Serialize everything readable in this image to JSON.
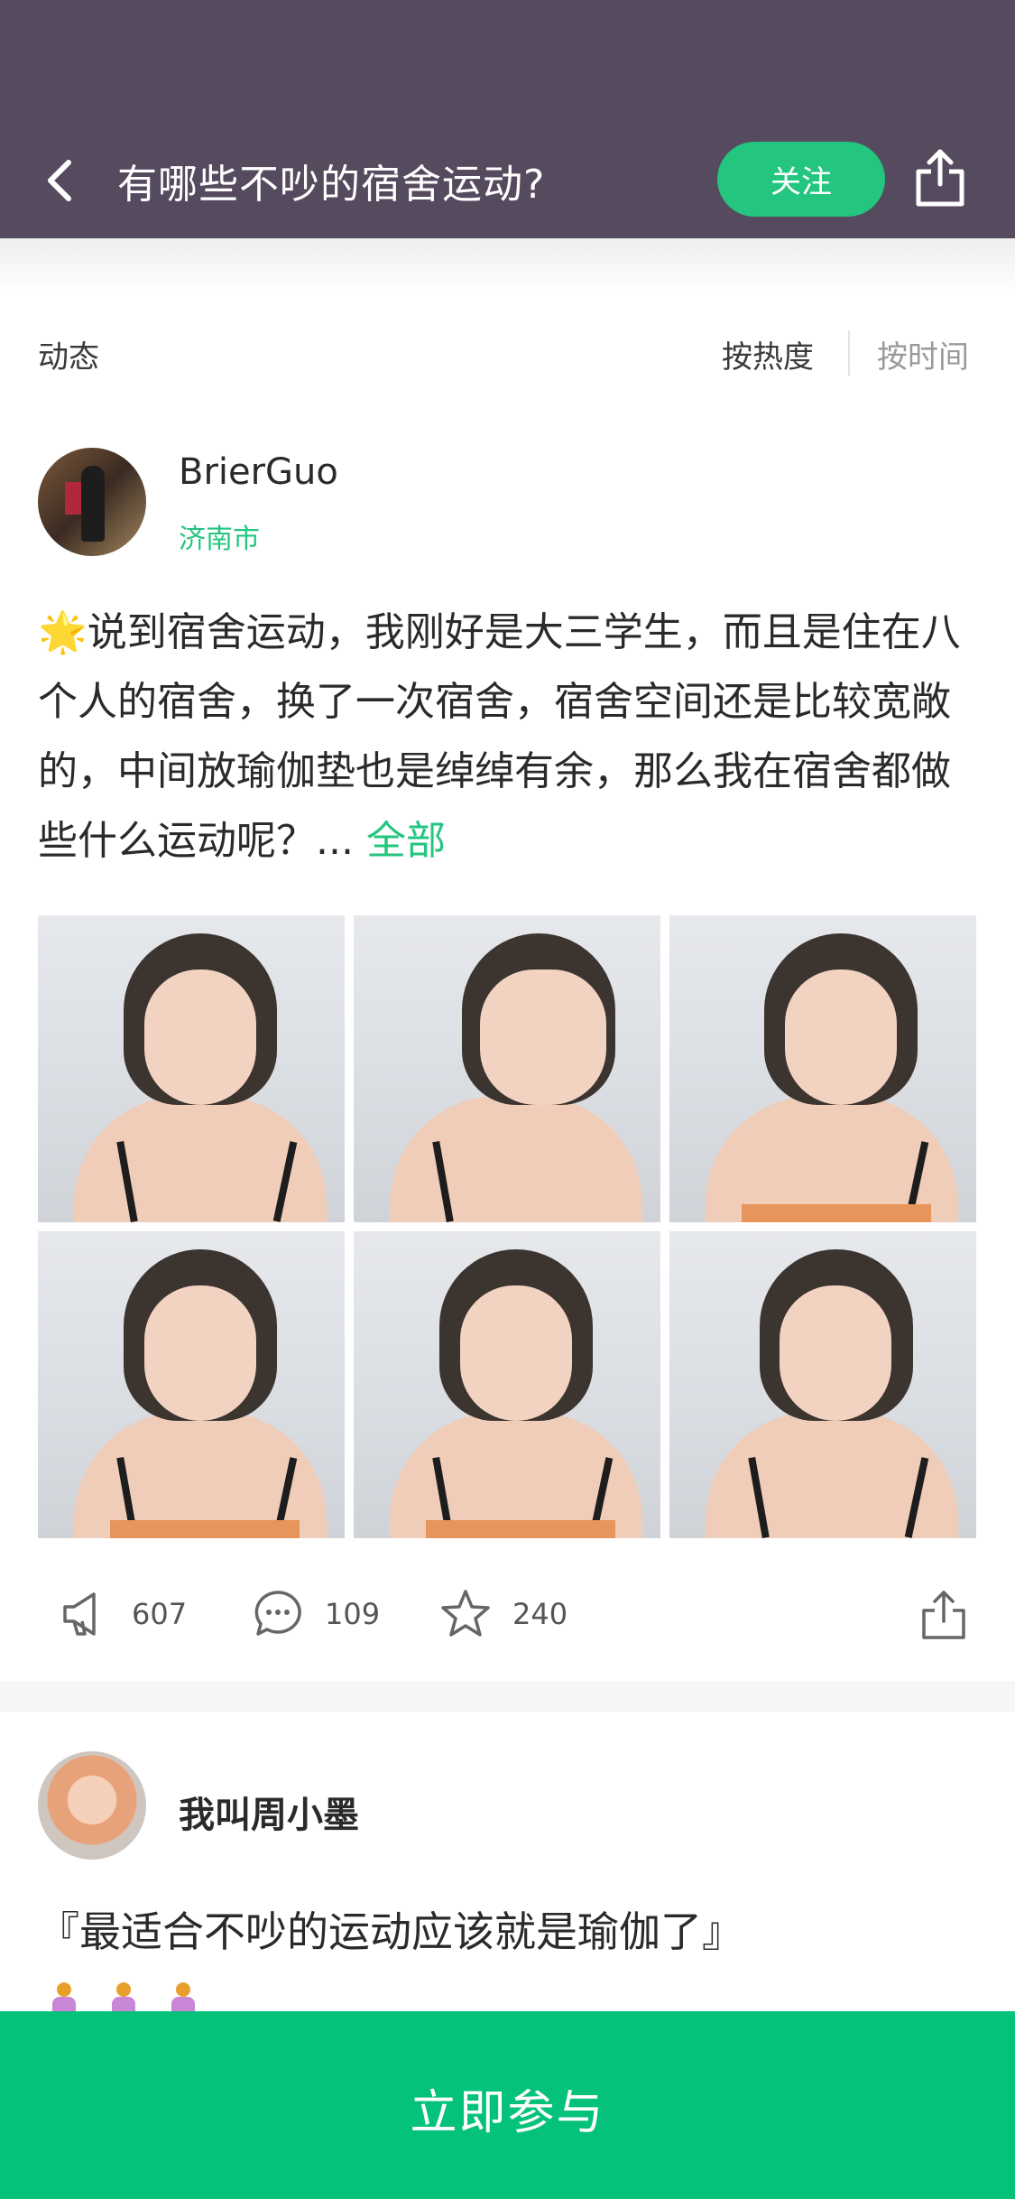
{
  "header": {
    "title": "有哪些不吵的宿舍运动?",
    "follow_label": "关注",
    "background": "#564a5e"
  },
  "sort": {
    "section_label": "动态",
    "by_hot": "按热度",
    "by_time": "按时间"
  },
  "posts": [
    {
      "username": "BrierGuo",
      "location": "济南市",
      "star": "🌟",
      "text": "说到宿舍运动，我刚好是大三学生，而且是住在八个人的宿舍，换了一次宿舍，宿舍空间还是比较宽敞的，中间放瑜伽垫也是绰绰有余，那么我在宿舍都做些什么运动呢？...",
      "more_label": "全部",
      "likes": "607",
      "comments": "109",
      "favorites": "240"
    },
    {
      "username": "我叫周小墨",
      "text": "『最适合不吵的运动应该就是瑜伽了』"
    }
  ],
  "cta": {
    "label": "立即参与",
    "color": "#05c27a"
  },
  "accent_color": "#23c57f"
}
